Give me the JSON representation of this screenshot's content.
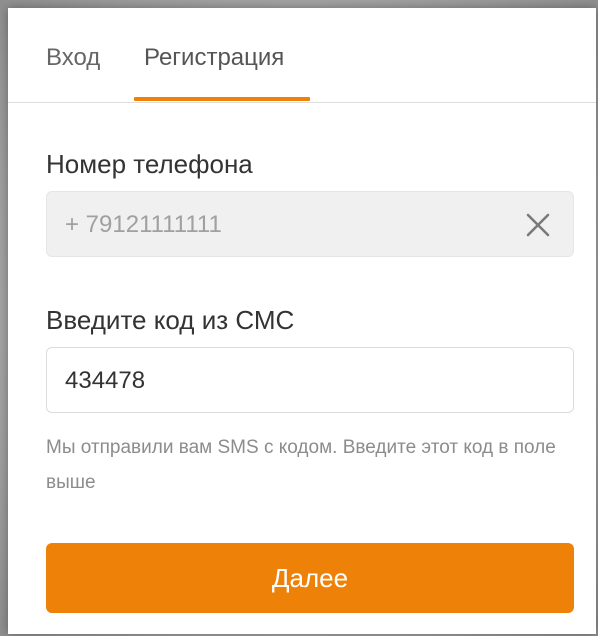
{
  "tabs": {
    "login_label": "Вход",
    "register_label": "Регистрация",
    "active": "register"
  },
  "phone": {
    "label": "Номер телефона",
    "value": "+ 79121111111"
  },
  "sms_code": {
    "label": "Введите код из СМС",
    "value": "434478",
    "hint": "Мы отправили вам SMS с кодом. Введите этот код в поле выше"
  },
  "actions": {
    "next_label": "Далее"
  },
  "colors": {
    "accent": "#ee8208",
    "disabled_input_bg": "#f0f0f0"
  },
  "icons": {
    "clear": "close-icon"
  }
}
